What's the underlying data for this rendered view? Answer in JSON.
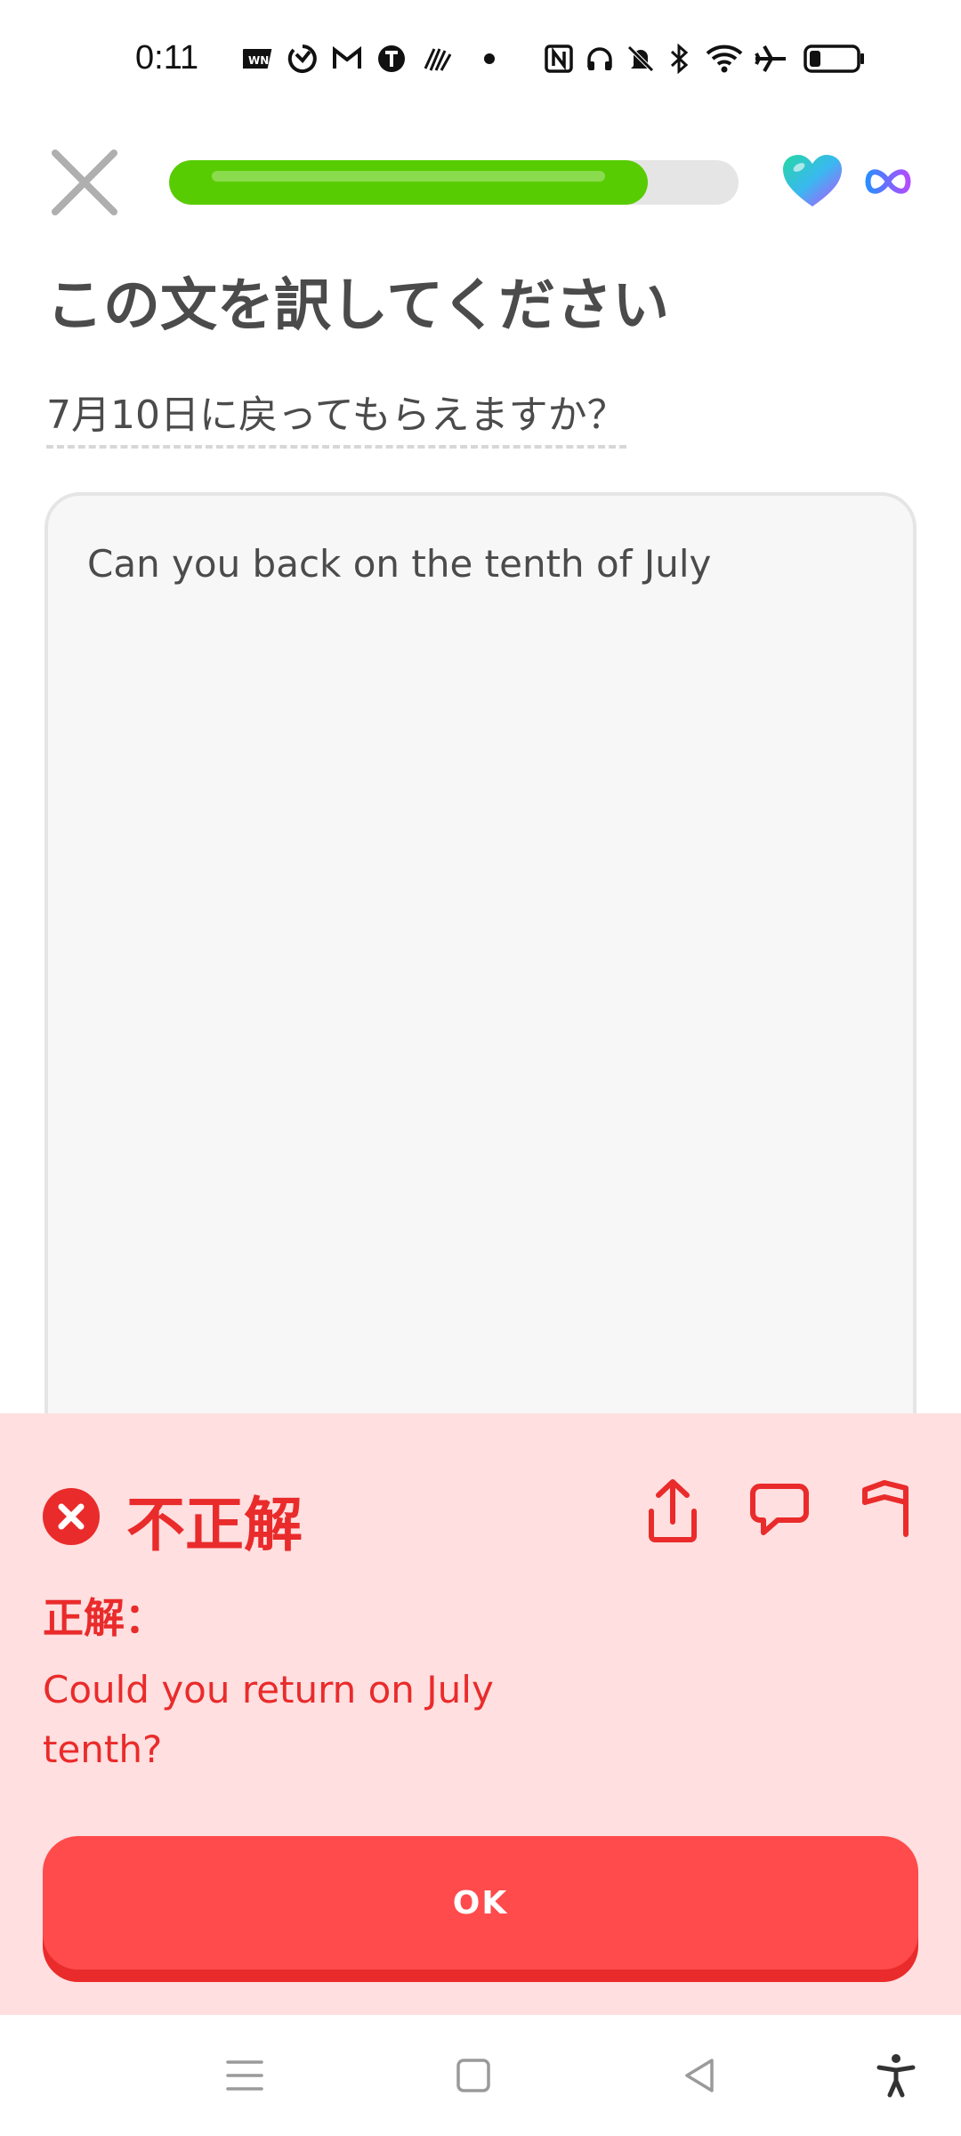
{
  "status_bar": {
    "time": "0:11",
    "icons": [
      "app-news-icon",
      "app-sync-icon",
      "gmail-icon",
      "app-t-icon",
      "app-fan-icon",
      "dot-icon",
      "nfc-icon",
      "headphones-icon",
      "bell-muted-icon",
      "bluetooth-icon",
      "wifi-icon",
      "airplane-icon",
      "battery-icon"
    ]
  },
  "header": {
    "progress": 0.84,
    "hearts_icon": "heart-icon",
    "hearts_value_icon": "infinity-icon"
  },
  "exercise": {
    "instruction": "この文を訳してください",
    "prompt": "7月10日に戻ってもらえますか？",
    "user_answer": "Can you back on the tenth of July"
  },
  "feedback": {
    "verdict": "不正解",
    "solution_label": "正解：",
    "solution": "Could you return on July tenth?",
    "ok_label": "OK",
    "colors": {
      "sheet_bg": "#ffdfe0",
      "accent": "#ea2b2b",
      "button": "#ff4b4b",
      "progress": "#58cc02"
    }
  },
  "nav_bar": {
    "icons": [
      "menu-icon",
      "home-icon",
      "back-icon",
      "accessibility-icon"
    ]
  }
}
